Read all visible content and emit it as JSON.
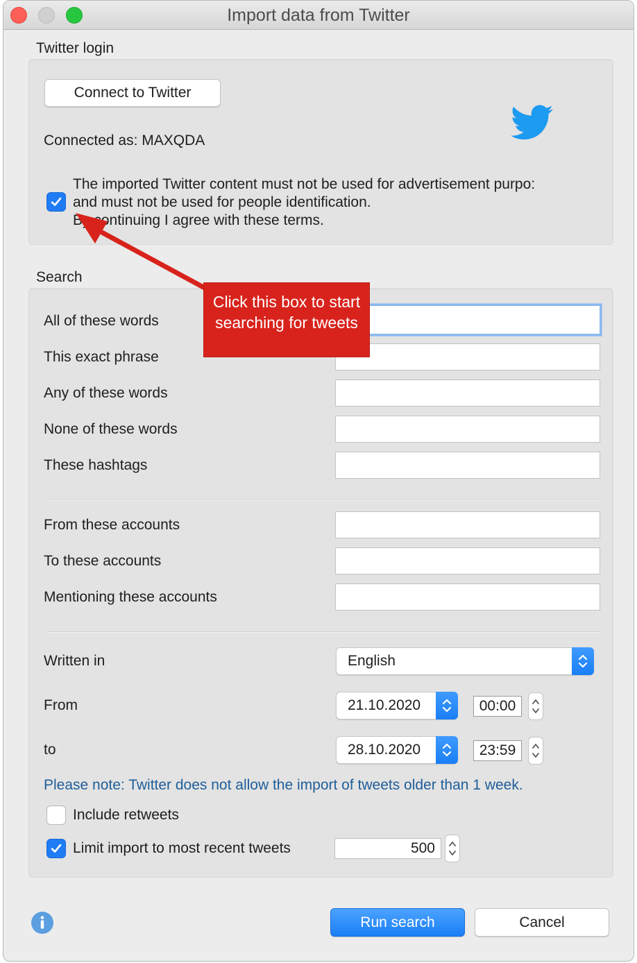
{
  "window": {
    "title": "Import data from Twitter"
  },
  "login": {
    "section_label": "Twitter login",
    "connect_button": "Connect to Twitter",
    "connected_as": "Connected as: MAXQDA",
    "terms_checked": true,
    "terms_line1": "The imported Twitter content must not be used for advertisement purpo:",
    "terms_line2": "and must not be used for people identification.",
    "terms_line3": "By continuing I agree with these terms."
  },
  "search": {
    "section_label": "Search",
    "fields": [
      {
        "label": "All of these words",
        "value": ""
      },
      {
        "label": "This exact phrase",
        "value": ""
      },
      {
        "label": "Any of these words",
        "value": ""
      },
      {
        "label": "None of  these words",
        "value": ""
      },
      {
        "label": "These hashtags",
        "value": ""
      }
    ],
    "account_fields": [
      {
        "label": "From these accounts",
        "value": ""
      },
      {
        "label": "To these accounts",
        "value": ""
      },
      {
        "label": "Mentioning these accounts",
        "value": ""
      }
    ],
    "language": {
      "label": "Written in",
      "value": "English"
    },
    "from": {
      "label": "From",
      "date": "21.10.2020",
      "time": "00:00"
    },
    "to": {
      "label": "to",
      "date": "28.10.2020",
      "time": "23:59"
    },
    "note": "Please note: Twitter does not allow the import of tweets older than 1 week.",
    "include_retweets": {
      "label": "Include retweets",
      "checked": false
    },
    "limit": {
      "label": "Limit import to most recent tweets",
      "checked": true,
      "value": "500"
    }
  },
  "footer": {
    "run_button": "Run search",
    "cancel_button": "Cancel"
  },
  "annotation": {
    "callout_text": "Click this box to start searching for tweets",
    "color": "#d8231c"
  },
  "colors": {
    "accent": "#1f7cf5",
    "twitter_blue": "#1d9bf0",
    "note_text": "#1f5e9a"
  }
}
